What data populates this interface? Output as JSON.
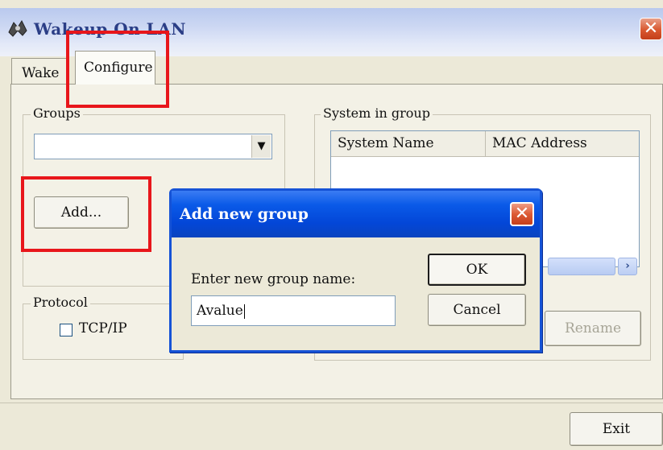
{
  "window": {
    "title": "Wakeup On LAN",
    "close_symbol": "✕"
  },
  "tabs": [
    {
      "label": "Wake"
    },
    {
      "label": "Configure"
    }
  ],
  "groups": {
    "legend": "Groups",
    "select_value": "",
    "add_label": "Add..."
  },
  "protocol": {
    "legend": "Protocol",
    "tcpip_label": "TCP/IP",
    "tcpip_checked": false
  },
  "system_in_group": {
    "legend": "System in group",
    "columns": [
      "System Name",
      "MAC Address"
    ],
    "rows": [],
    "rename_label": "Rename"
  },
  "footer": {
    "exit_label": "Exit"
  },
  "dialog": {
    "title": "Add new group",
    "prompt": "Enter new group name:",
    "input_value": "Avalue",
    "ok_label": "OK",
    "cancel_label": "Cancel"
  },
  "colors": {
    "annotation_red": "#e8161b",
    "dialog_title_blue": "#0a5ae8",
    "close_red": "#d9582f"
  }
}
